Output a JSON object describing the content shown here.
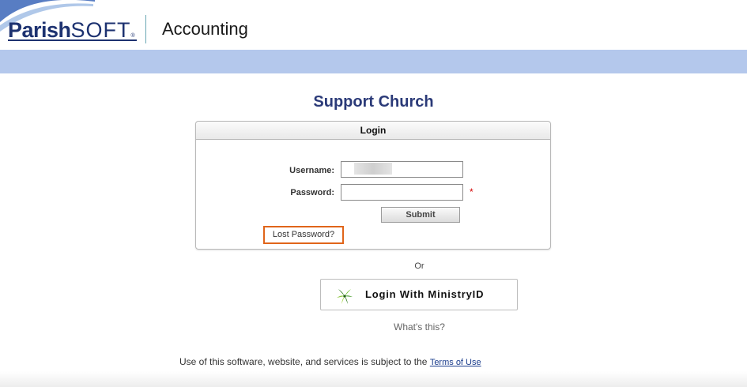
{
  "header": {
    "logo_parish": "Parish",
    "logo_soft": "SOFT",
    "logo_reg": "®",
    "app_title": "Accounting"
  },
  "church_name": "Support Church",
  "login": {
    "heading": "Login",
    "username_label": "Username:",
    "username_value": "",
    "password_label": "Password:",
    "password_value": "",
    "required_mark": "*",
    "submit_label": "Submit",
    "lost_password_label": "Lost Password?"
  },
  "or_text": "Or",
  "ministryid": {
    "button_label": "Login With MinistryID",
    "whats_this": "What's this?"
  },
  "footer": {
    "notice": "Use of this software, website, and services is subject to the ",
    "terms_link": "Terms of Use"
  },
  "colors": {
    "brand_navy": "#1d3270",
    "band": "#b4c8ec",
    "highlight_orange": "#e0651a",
    "required_red": "#d40000"
  }
}
